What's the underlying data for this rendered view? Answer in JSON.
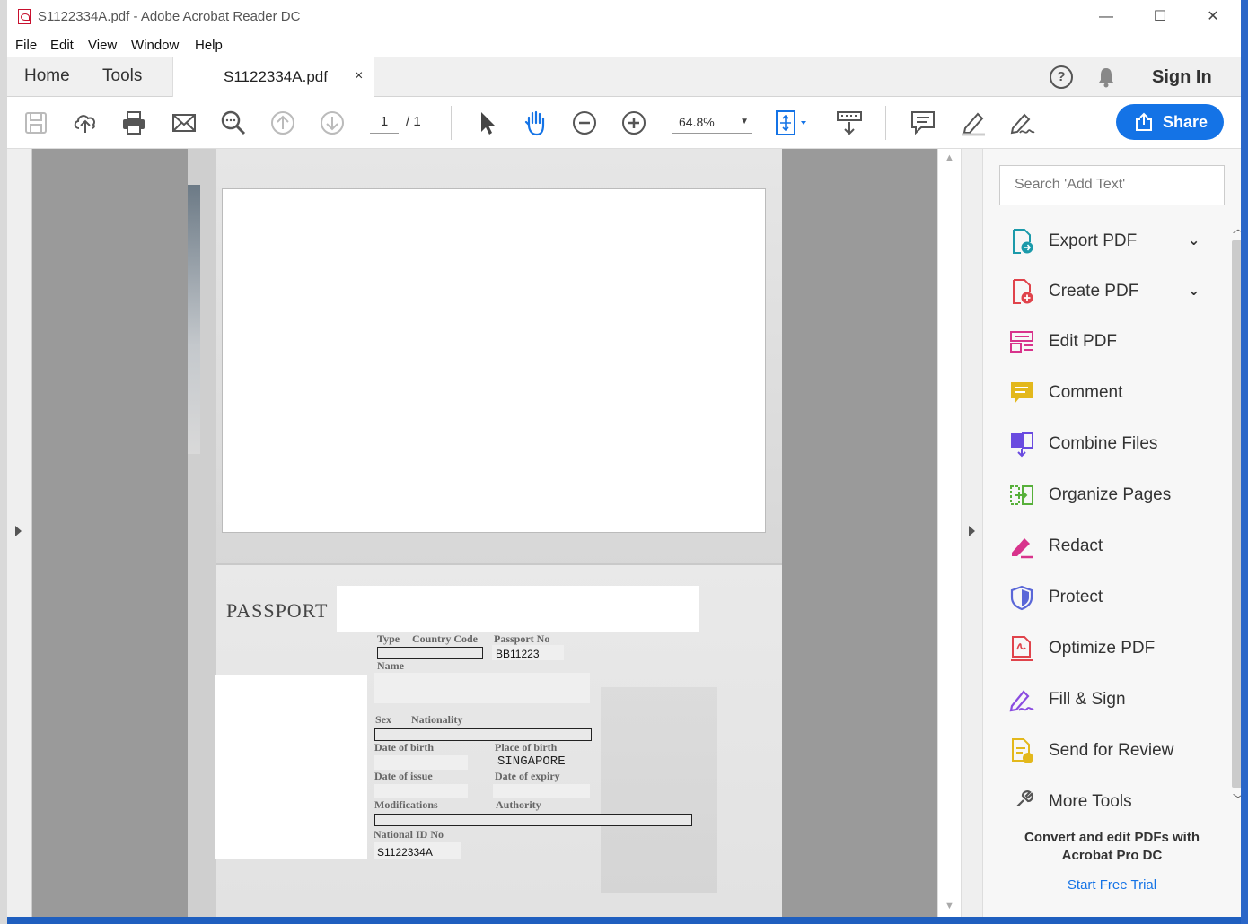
{
  "window": {
    "title": "S1122334A.pdf - Adobe Acrobat Reader DC",
    "controls": {
      "minimize": "—",
      "maximize": "☐",
      "close": "✕"
    }
  },
  "menu": [
    "File",
    "Edit",
    "View",
    "Window",
    "Help"
  ],
  "tabs": {
    "home": "Home",
    "tools": "Tools",
    "document": "S1122334A.pdf",
    "close": "×",
    "help": "?",
    "sign_in": "Sign In"
  },
  "toolbar": {
    "current_page": "1",
    "total_pages": "/ 1",
    "zoom": "64.8%",
    "share": "Share"
  },
  "document": {
    "passport_title": "PASSPORT",
    "labels": {
      "type": "Type",
      "country_code": "Country Code",
      "passport_no": "Passport No",
      "name": "Name",
      "sex": "Sex",
      "nationality": "Nationality",
      "date_of_birth": "Date of birth",
      "place_of_birth": "Place of birth",
      "date_of_issue": "Date of issue",
      "date_of_expiry": "Date of expiry",
      "modifications": "Modifications",
      "authority": "Authority",
      "national_id_no": "National ID No"
    },
    "values": {
      "passport_no": "BB11223",
      "place_of_birth": "SINGAPORE",
      "national_id_no": "S1122334A"
    }
  },
  "right_panel": {
    "search_placeholder": "Search 'Add Text'",
    "tools": [
      {
        "label": "Export PDF",
        "icon": "export-pdf-icon",
        "expandable": true,
        "color": "#1b9aaa"
      },
      {
        "label": "Create PDF",
        "icon": "create-pdf-icon",
        "expandable": true,
        "color": "#e0434b"
      },
      {
        "label": "Edit PDF",
        "icon": "edit-pdf-icon",
        "expandable": false,
        "color": "#d8338c"
      },
      {
        "label": "Comment",
        "icon": "comment-icon",
        "expandable": false,
        "color": "#e3b81c"
      },
      {
        "label": "Combine Files",
        "icon": "combine-files-icon",
        "expandable": false,
        "color": "#6a4be0"
      },
      {
        "label": "Organize Pages",
        "icon": "organize-pages-icon",
        "expandable": false,
        "color": "#57b03a"
      },
      {
        "label": "Redact",
        "icon": "redact-icon",
        "expandable": false,
        "color": "#d8338c"
      },
      {
        "label": "Protect",
        "icon": "protect-icon",
        "expandable": false,
        "color": "#5a67d8"
      },
      {
        "label": "Optimize PDF",
        "icon": "optimize-pdf-icon",
        "expandable": false,
        "color": "#e0434b"
      },
      {
        "label": "Fill & Sign",
        "icon": "fill-sign-icon",
        "expandable": false,
        "color": "#8a4be0"
      },
      {
        "label": "Send for Review",
        "icon": "send-for-review-icon",
        "expandable": false,
        "color": "#e3b81c"
      },
      {
        "label": "More Tools",
        "icon": "more-tools-icon",
        "expandable": false,
        "color": "#555555"
      }
    ],
    "promo": "Convert and edit PDFs with Acrobat Pro DC",
    "trial_link": "Start Free Trial"
  },
  "colors": {
    "accent": "#1473e6",
    "viewer_bg": "#9a9a9a"
  }
}
